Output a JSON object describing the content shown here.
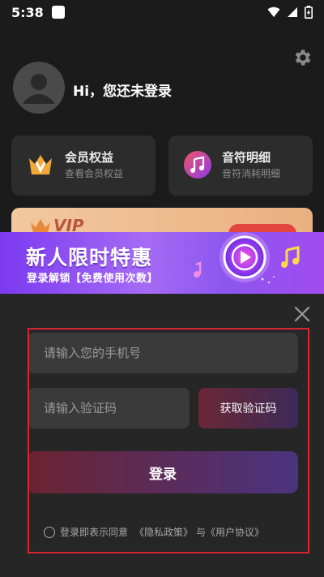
{
  "status_bar": {
    "time": "5:38"
  },
  "profile": {
    "greeting": "Hi，您还未登录"
  },
  "cards": [
    {
      "title": "会员权益",
      "subtitle": "查看会员权益",
      "icon": "vip-crown-icon"
    },
    {
      "title": "音符明细",
      "subtitle": "音符消耗明细",
      "icon": "music-note-icon"
    }
  ],
  "vip_strip": {
    "text": "VIP"
  },
  "promo": {
    "title": "新人限时特惠",
    "subtitle": "登录解锁【免费使用次数】"
  },
  "login": {
    "phone_placeholder": "请输入您的手机号",
    "code_placeholder": "请输入验证码",
    "get_code_label": "获取验证码",
    "login_label": "登录",
    "agreement_prefix": "登录即表示同意",
    "privacy_link": "《隐私政策》",
    "and_text": "与",
    "user_agreement_link": "《用户协议》"
  },
  "colors": {
    "background": "#1b1b1b",
    "card": "#2c2c2c",
    "modal": "#262626",
    "promo_purple": "#8c56ef",
    "highlight_red": "#d7262f"
  }
}
